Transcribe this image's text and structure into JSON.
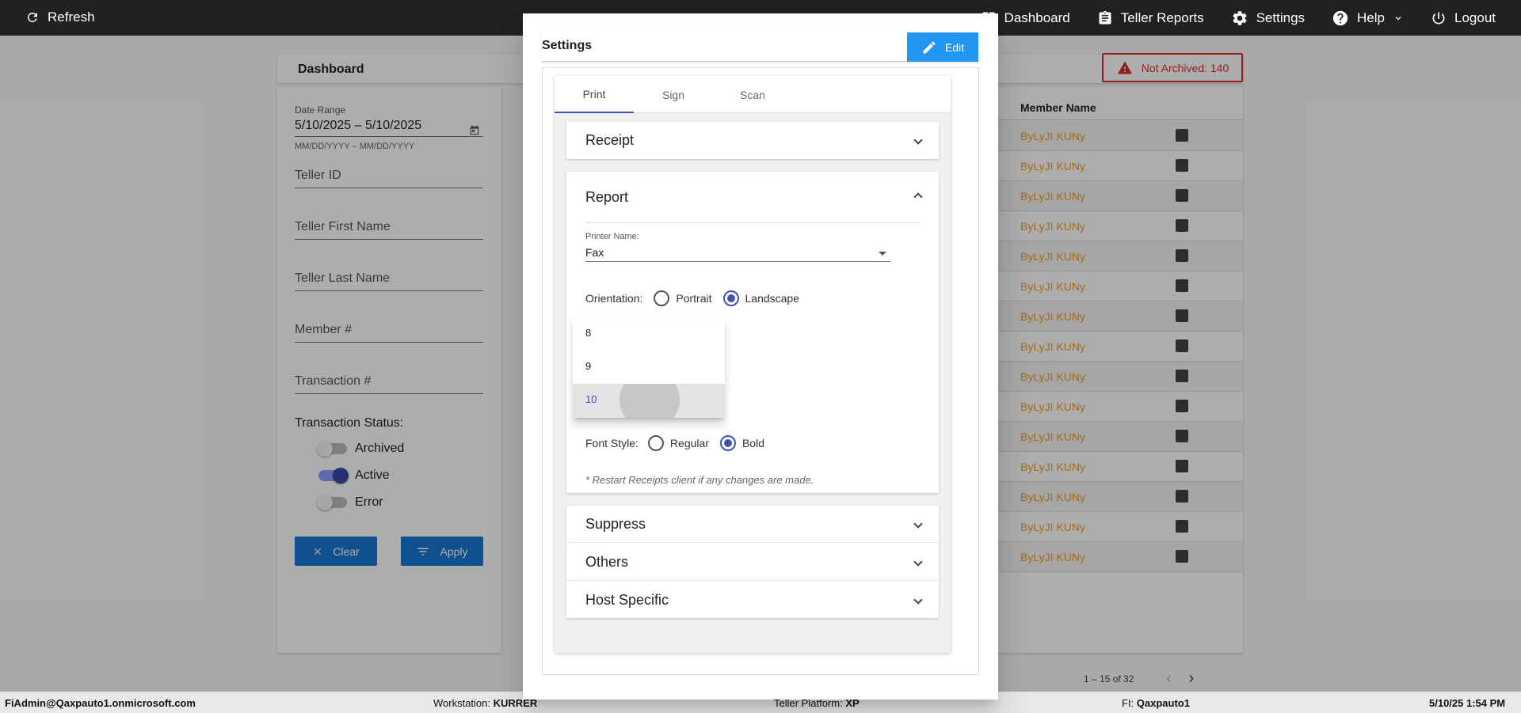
{
  "topbar": {
    "refresh": "Refresh",
    "dashboard": "Dashboard",
    "teller_reports": "Teller Reports",
    "settings": "Settings",
    "help": "Help",
    "logout": "Logout"
  },
  "dashboard": {
    "title": "Dashboard",
    "not_archived": "Not Archived: 140",
    "filters": {
      "date_range_label": "Date Range",
      "date_range_value": "5/10/2025 – 5/10/2025",
      "date_range_hint": "MM/DD/YYYY – MM/DD/YYYY",
      "teller_id": "Teller ID",
      "teller_first_name": "Teller First Name",
      "teller_last_name": "Teller Last Name",
      "member_no": "Member #",
      "transaction_no": "Transaction #",
      "status_label": "Transaction Status:",
      "archived": "Archived",
      "active": "Active",
      "error": "Error",
      "clear": "Clear",
      "apply": "Apply"
    },
    "table": {
      "column": "Member Name",
      "rows": [
        "ByLyJI KUNy",
        "ByLyJI KUNy",
        "ByLyJI KUNy",
        "ByLyJI KUNy",
        "ByLyJI KUNy",
        "ByLyJI KUNy",
        "ByLyJI KUNy",
        "ByLyJI KUNy",
        "ByLyJI KUNy",
        "ByLyJI KUNy",
        "ByLyJI KUNy",
        "ByLyJI KUNy",
        "ByLyJI KUNy",
        "ByLyJI KUNy",
        "ByLyJI KUNy"
      ],
      "pager": "1 – 15 of 32"
    }
  },
  "modal": {
    "title": "Settings",
    "edit": "Edit",
    "tabs": [
      "Print",
      "Sign",
      "Scan"
    ],
    "receipt": "Receipt",
    "report": "Report",
    "printer_label": "Printer Name:",
    "printer_value": "Fax",
    "orientation_label": "Orientation:",
    "portrait": "Portrait",
    "landscape": "Landscape",
    "font_style_label": "Font Style:",
    "regular": "Regular",
    "bold": "Bold",
    "note": "* Restart Receipts client if any changes are made.",
    "suppress": "Suppress",
    "others": "Others",
    "host_specific": "Host Specific",
    "dropdown_options": [
      "8",
      "9",
      "10"
    ]
  },
  "statusbar": {
    "user": "FiAdmin@Qaxpauto1.onmicrosoft.com",
    "workstation_label": "Workstation:",
    "workstation": "KURRER",
    "platform_label": "Teller Platform:",
    "platform": "XP",
    "fi_label": "FI:",
    "fi": "Qaxpauto1",
    "datetime": "5/10/25 1:54 PM"
  }
}
